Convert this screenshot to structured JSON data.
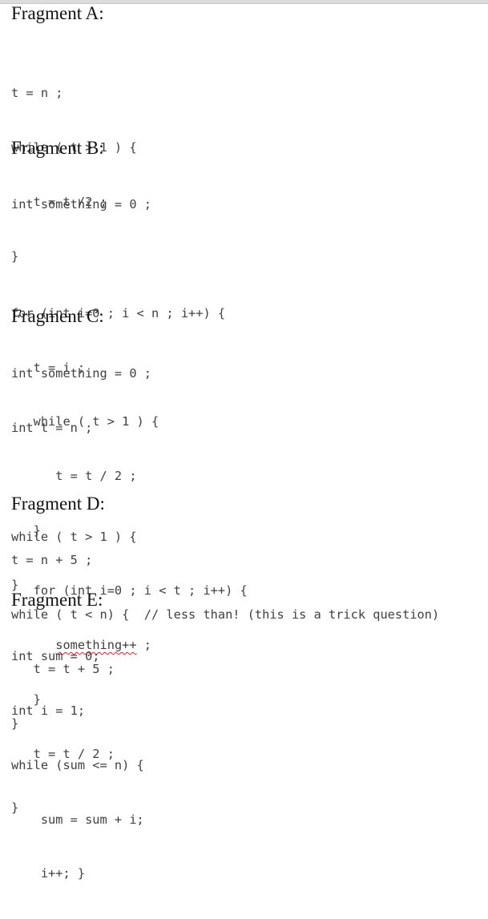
{
  "fragments": [
    {
      "title": "Fragment A:",
      "lines": [
        "",
        "t = n ;",
        "while ( t > 1 ) {",
        "   t = t /2 ;",
        "}"
      ]
    },
    {
      "title": "Fragment B:",
      "lines": [
        "int something = 0 ;",
        "",
        "for (int i=0 ; i < n ; i++) {",
        "   t = i ;",
        "   while ( t > 1 ) {",
        "      t = t / 2 ;",
        "   }",
        "}"
      ]
    },
    {
      "title": "Fragment C:",
      "lines": [
        "int something = 0 ;",
        "int t = n ;",
        "",
        "while ( t > 1 ) {",
        "   for (int i=0 ; i < t ; i++) {",
        "      something++ ;",
        "   }",
        "   t = t / 2 ;",
        "}"
      ],
      "spellcheck_word": "something++"
    },
    {
      "title": "Fragment D:",
      "lines": [
        "t = n + 5 ;",
        "while ( t < n) {  // less than! (this is a trick question)",
        "   t = t + 5 ;",
        "}"
      ]
    },
    {
      "title": "Fragment E:",
      "lines": [
        "int sum = 0;",
        "int i = 1;",
        "while (sum <= n) {",
        "    sum = sum + i;",
        "    i++; }"
      ]
    }
  ],
  "colors": {
    "heading_text": "#111111",
    "code_text": "#404040",
    "spellcheck_underline": "#e02020"
  }
}
